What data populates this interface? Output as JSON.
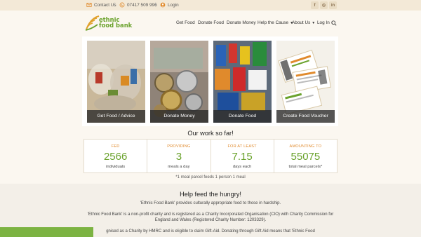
{
  "topbar": {
    "contact_label": "Contact Us",
    "phone": "07417 509 996",
    "login_label": "Login",
    "separator": "|",
    "social": [
      "f",
      "◎",
      "in"
    ]
  },
  "logo": {
    "line1": "ethnic",
    "line2": "food bank"
  },
  "nav": {
    "items": [
      "Get Food",
      "Donate Food",
      "Donate Money",
      "Help the Cause",
      "About Us",
      "Log In"
    ]
  },
  "cards": [
    {
      "label": "Get Food / Advice"
    },
    {
      "label": "Donate Money"
    },
    {
      "label": "Donate Food"
    },
    {
      "label": "Create Food Voucher"
    }
  ],
  "work_title": "Our work so far!",
  "stats": [
    {
      "head": "FED",
      "value": "2566",
      "sub": "individuals"
    },
    {
      "head": "PROVIDING",
      "value": "3",
      "sub": "meals a day"
    },
    {
      "head": "FOR AT LEAST",
      "value": "7.15",
      "sub": "days each"
    },
    {
      "head": "AMOUNTING TO",
      "value": "55075",
      "sub": "total meal parcels*"
    }
  ],
  "note": "*1 meal parcel feeds 1 person 1 meal",
  "help": {
    "title": "Help feed the hungry!",
    "p1": "'Ethnic Food Bank' provides culturally appropriate food to those in hardship.",
    "p2a": "'Ethnic Food Bank' is a non-profit charity and is registered as a Charity Incorporated Organisation (CIO) with Charity Commission for",
    "p2b": "England and Wales (Registered Charity Number: 1203329).",
    "p3": "gnised as a Charity by HMRC and is eligible to claim Gift-Aid. Donating through Gift Aid means that 'Ethnic Food"
  },
  "colors": {
    "brand_green": "#6aa22c",
    "accent_orange": "#e08a2c",
    "topbar_bg": "#f3e9d7"
  }
}
